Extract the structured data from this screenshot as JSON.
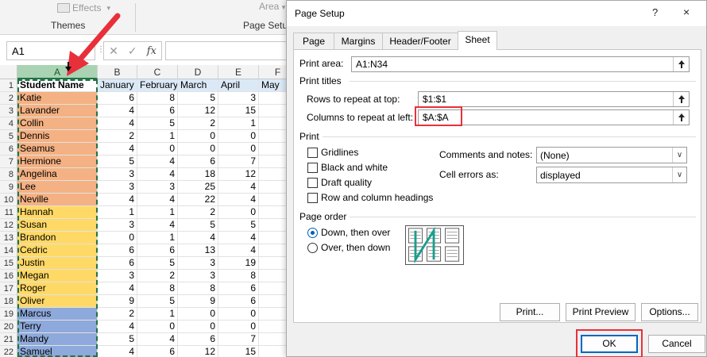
{
  "ribbon": {
    "effects_label": "Effects",
    "themes_label": "Themes",
    "area_label": "Area",
    "page_setup_label": "Page Setu"
  },
  "formula_bar": {
    "name_box": "A1",
    "fx_label": "fx",
    "formula": ""
  },
  "sheet": {
    "column_headers": [
      "A",
      "B",
      "C",
      "D",
      "E",
      "F"
    ],
    "selected_column": "A",
    "header_row": [
      "Student Name",
      "January",
      "February",
      "March",
      "April",
      "May"
    ],
    "rows": [
      {
        "n": "2",
        "name": "Katie",
        "vals": [
          "6",
          "8",
          "5",
          "3"
        ]
      },
      {
        "n": "3",
        "name": "Lavander",
        "vals": [
          "4",
          "6",
          "12",
          "15"
        ]
      },
      {
        "n": "4",
        "name": "Collin",
        "vals": [
          "4",
          "5",
          "2",
          "1"
        ]
      },
      {
        "n": "5",
        "name": "Dennis",
        "vals": [
          "2",
          "1",
          "0",
          "0"
        ]
      },
      {
        "n": "6",
        "name": "Seamus",
        "vals": [
          "4",
          "0",
          "0",
          "0"
        ]
      },
      {
        "n": "7",
        "name": "Hermione",
        "vals": [
          "5",
          "4",
          "6",
          "7"
        ]
      },
      {
        "n": "8",
        "name": "Angelina",
        "vals": [
          "3",
          "4",
          "18",
          "12"
        ]
      },
      {
        "n": "9",
        "name": "Lee",
        "vals": [
          "3",
          "3",
          "25",
          "4"
        ]
      },
      {
        "n": "10",
        "name": "Neville",
        "vals": [
          "4",
          "4",
          "22",
          "4"
        ]
      },
      {
        "n": "11",
        "name": "Hannah",
        "vals": [
          "1",
          "1",
          "2",
          "0"
        ]
      },
      {
        "n": "12",
        "name": "Susan",
        "vals": [
          "3",
          "4",
          "5",
          "5"
        ]
      },
      {
        "n": "13",
        "name": "Brandon",
        "vals": [
          "0",
          "1",
          "4",
          "4"
        ]
      },
      {
        "n": "14",
        "name": "Cedric",
        "vals": [
          "6",
          "6",
          "13",
          "4"
        ]
      },
      {
        "n": "15",
        "name": "Justin",
        "vals": [
          "6",
          "5",
          "3",
          "19"
        ]
      },
      {
        "n": "16",
        "name": "Megan",
        "vals": [
          "3",
          "2",
          "3",
          "8"
        ]
      },
      {
        "n": "17",
        "name": "Roger",
        "vals": [
          "4",
          "8",
          "8",
          "6"
        ]
      },
      {
        "n": "18",
        "name": "Oliver",
        "vals": [
          "9",
          "5",
          "9",
          "6"
        ]
      },
      {
        "n": "19",
        "name": "Marcus",
        "vals": [
          "2",
          "1",
          "0",
          "0"
        ]
      },
      {
        "n": "20",
        "name": "Terry",
        "vals": [
          "4",
          "0",
          "0",
          "0"
        ]
      },
      {
        "n": "21",
        "name": "Mandy",
        "vals": [
          "5",
          "4",
          "6",
          "7"
        ]
      },
      {
        "n": "22",
        "name": "Samuel",
        "vals": [
          "4",
          "6",
          "12",
          "15"
        ]
      }
    ],
    "group_colors": {
      "orange": "#f4b183",
      "yellow": "#ffd966",
      "blue": "#8ea9db"
    }
  },
  "dialog": {
    "title": "Page Setup",
    "help_icon": "?",
    "close_icon": "×",
    "tabs": [
      "Page",
      "Margins",
      "Header/Footer",
      "Sheet"
    ],
    "active_tab": "Sheet",
    "print_area_label": "Print area:",
    "print_area_value": "A1:N34",
    "print_titles_label": "Print titles",
    "rows_repeat_label": "Rows to repeat at top:",
    "rows_repeat_value": "$1:$1",
    "cols_repeat_label": "Columns to repeat at left:",
    "cols_repeat_value": "$A:$A",
    "print_section_label": "Print",
    "checkboxes": [
      "Gridlines",
      "Black and white",
      "Draft quality",
      "Row and column headings"
    ],
    "comments_label": "Comments and notes:",
    "comments_value": "(None)",
    "cell_errors_label": "Cell errors as:",
    "cell_errors_value": "displayed",
    "page_order_label": "Page order",
    "radio_down": "Down, then over",
    "radio_over": "Over, then down",
    "print_button": "Print...",
    "preview_button": "Print Preview",
    "options_button": "Options...",
    "ok_button": "OK",
    "cancel_button": "Cancel"
  },
  "colors": {
    "accent_green": "#217346",
    "highlight_red": "#e8303a",
    "header_blue": "#dbe9f7"
  }
}
